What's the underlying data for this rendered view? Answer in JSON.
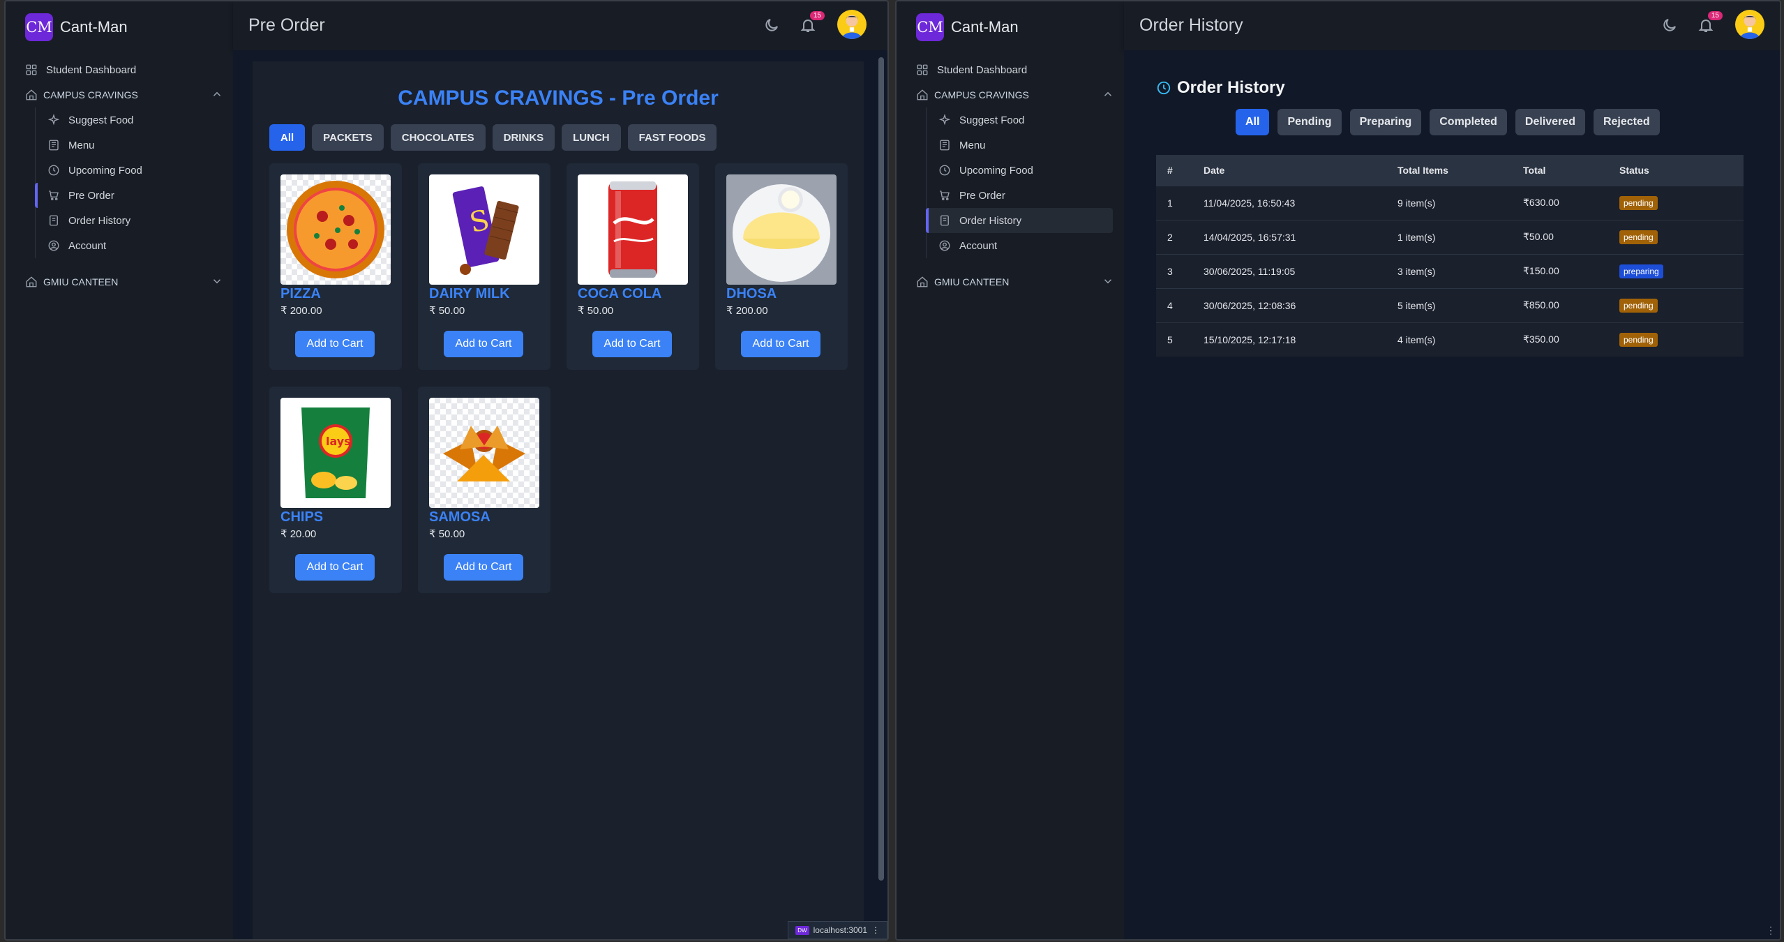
{
  "app": {
    "logo_mark": "CM",
    "name": "Cant-Man"
  },
  "sidebar": {
    "dashboard": "Student Dashboard",
    "section1": "CAMPUS CRAVINGS",
    "items": [
      "Suggest Food",
      "Menu",
      "Upcoming Food",
      "Pre Order",
      "Order History",
      "Account"
    ],
    "section2": "GMIU CANTEEN"
  },
  "notifications": {
    "count": "15"
  },
  "left": {
    "page_title": "Pre Order",
    "heading": "CAMPUS CRAVINGS - Pre Order",
    "categories": [
      "All",
      "PACKETS",
      "CHOCOLATES",
      "DRINKS",
      "LUNCH",
      "FAST FOODS"
    ],
    "active_category": "All",
    "products": [
      {
        "name": "PIZZA",
        "price": "₹ 200.00",
        "button": "Add to Cart"
      },
      {
        "name": "DAIRY MILK",
        "price": "₹ 50.00",
        "button": "Add to Cart"
      },
      {
        "name": "COCA COLA",
        "price": "₹ 50.00",
        "button": "Add to Cart"
      },
      {
        "name": "DHOSA",
        "price": "₹ 200.00",
        "button": "Add to Cart"
      },
      {
        "name": "CHIPS",
        "price": "₹ 20.00",
        "button": "Add to Cart"
      },
      {
        "name": "SAMOSA",
        "price": "₹ 50.00",
        "button": "Add to Cart"
      }
    ],
    "status_url": "localhost:3001"
  },
  "right": {
    "page_title": "Order History",
    "heading": "Order History",
    "filters": [
      "All",
      "Pending",
      "Preparing",
      "Completed",
      "Delivered",
      "Rejected"
    ],
    "active_filter": "All",
    "columns": [
      "#",
      "Date",
      "Total Items",
      "Total",
      "Status"
    ],
    "rows": [
      {
        "n": "1",
        "date": "11/04/2025, 16:50:43",
        "items": "9 item(s)",
        "total": "₹630.00",
        "status": "pending"
      },
      {
        "n": "2",
        "date": "14/04/2025, 16:57:31",
        "items": "1 item(s)",
        "total": "₹50.00",
        "status": "pending"
      },
      {
        "n": "3",
        "date": "30/06/2025, 11:19:05",
        "items": "3 item(s)",
        "total": "₹150.00",
        "status": "preparing"
      },
      {
        "n": "4",
        "date": "30/06/2025, 12:08:36",
        "items": "5 item(s)",
        "total": "₹850.00",
        "status": "pending"
      },
      {
        "n": "5",
        "date": "15/10/2025, 12:17:18",
        "items": "4 item(s)",
        "total": "₹350.00",
        "status": "pending"
      }
    ]
  },
  "colors": {
    "accent": "#3b82f6",
    "pending": "#a16207",
    "preparing": "#1d4ed8",
    "badge": "#db2777",
    "brand": "#6d28d9"
  }
}
